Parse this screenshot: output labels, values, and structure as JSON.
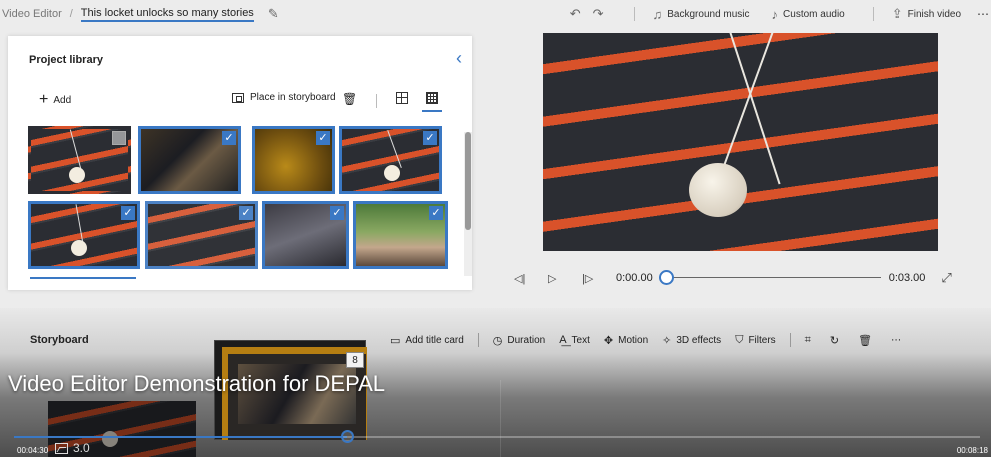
{
  "topbar": {
    "breadcrumb_root": "Video Editor",
    "breadcrumb_sep": "/",
    "project_title": "This locket unlocks so many stories",
    "edit_icon": "pencil-icon",
    "undo_icon": "undo-icon",
    "redo_icon": "redo-icon",
    "background_music": "Background music",
    "custom_audio": "Custom audio",
    "finish_video": "Finish video",
    "more": "⋯"
  },
  "library": {
    "title": "Project library",
    "collapse_icon": "chevron-left-icon",
    "add_label": "Add",
    "place_label": "Place in storyboard",
    "delete_icon": "trash-icon",
    "view_small_icon": "grid-small-icon",
    "view_large_icon": "grid-large-icon",
    "items": [
      {
        "name": "locket-knit",
        "selected": false
      },
      {
        "name": "party-photos",
        "selected": true
      },
      {
        "name": "gold-field",
        "selected": true
      },
      {
        "name": "locket-knit-2",
        "selected": true
      },
      {
        "name": "locket-knit-3",
        "selected": true
      },
      {
        "name": "locket-wear",
        "selected": true
      },
      {
        "name": "jewelry-table",
        "selected": true
      },
      {
        "name": "family-selfie",
        "selected": true
      }
    ]
  },
  "player": {
    "current_time": "0:00.00",
    "end_time": "0:03.00",
    "rewind_icon": "skip-back-icon",
    "play_icon": "play-icon",
    "forward_icon": "skip-forward-icon",
    "expand_icon": "expand-icon"
  },
  "storyboard": {
    "title": "Storyboard",
    "add_title_card": "Add title card",
    "duration": "Duration",
    "text": "Text",
    "motion": "Motion",
    "effects_3d": "3D effects",
    "filters": "Filters",
    "more": "⋯",
    "stack_count": "8",
    "clip_duration": "3.0"
  },
  "video_overlay": {
    "title": "Video Editor Demonstration for DEPAL",
    "elapsed": "00:04:30",
    "total": "00:08:18",
    "progress": 0.345
  }
}
